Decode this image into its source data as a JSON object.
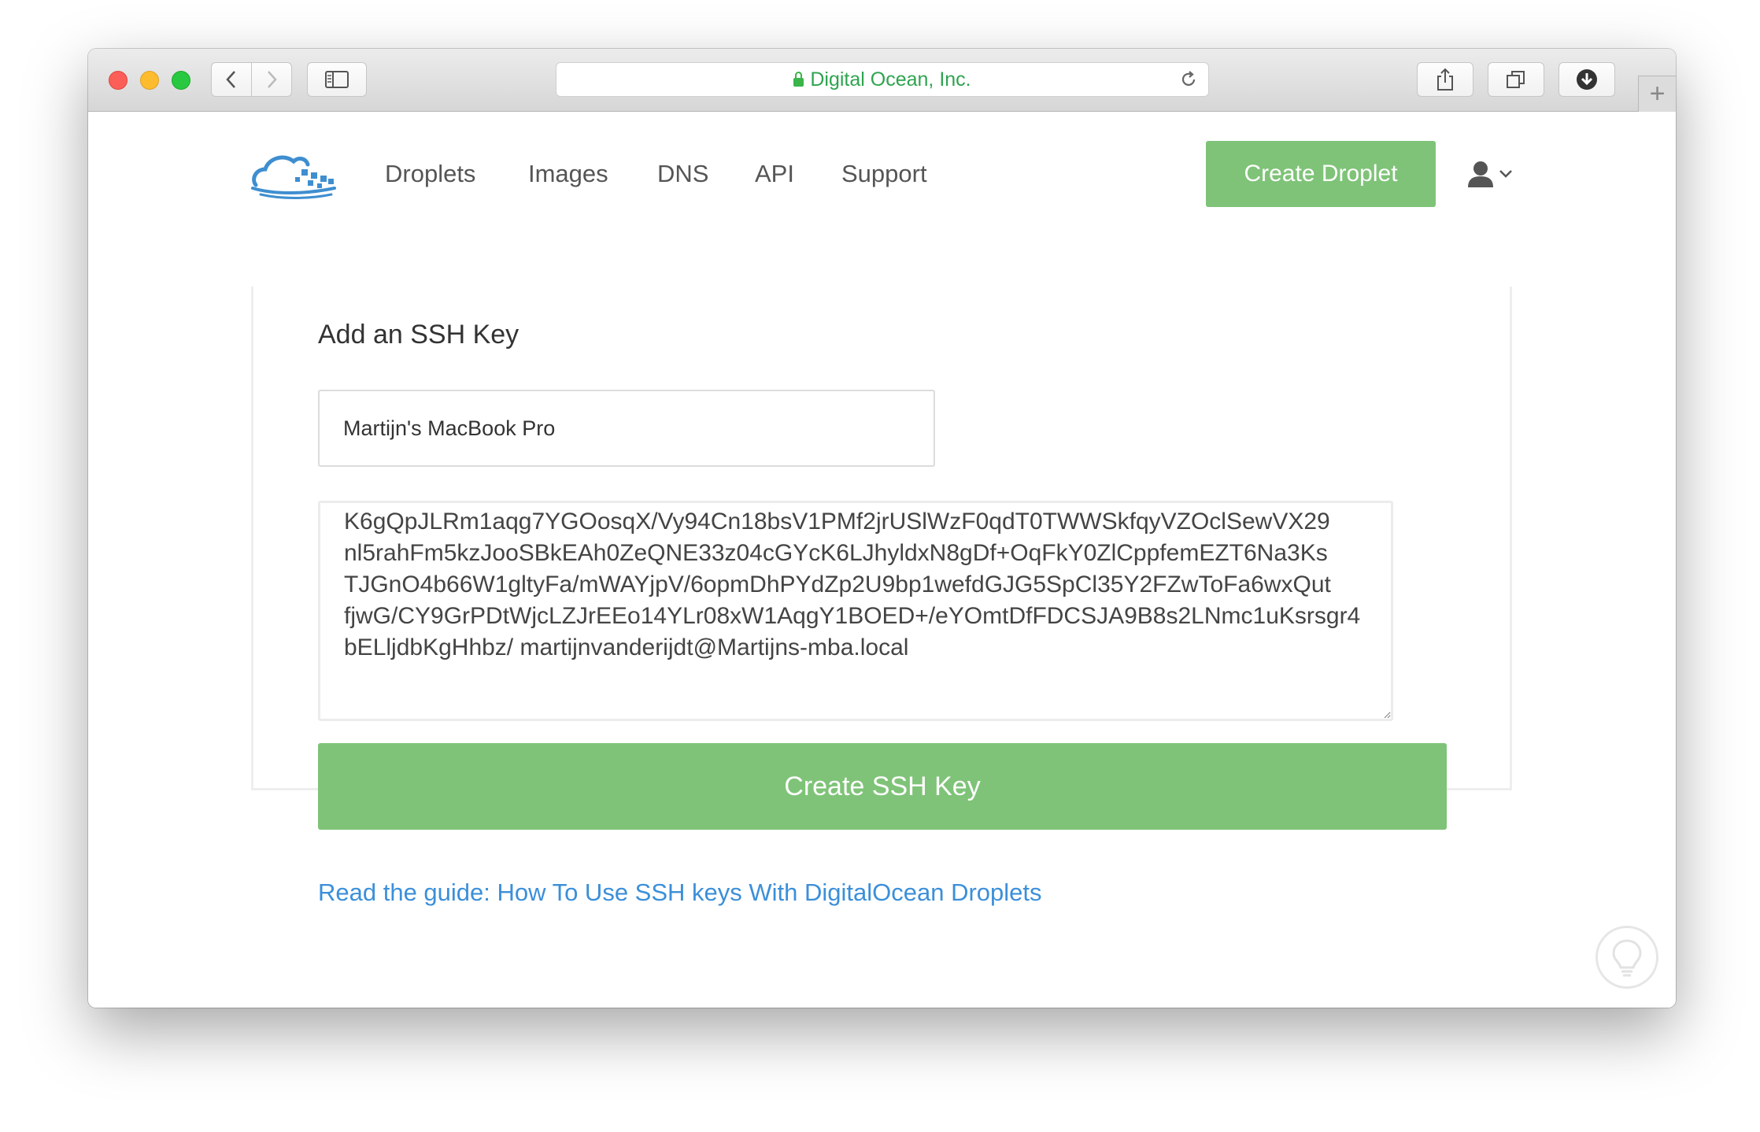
{
  "browser": {
    "address_site": "Digital Ocean, Inc.",
    "new_tab_label": "+"
  },
  "nav": {
    "items": [
      {
        "label": "Droplets"
      },
      {
        "label": "Images"
      },
      {
        "label": "DNS"
      },
      {
        "label": "API"
      },
      {
        "label": "Support"
      }
    ],
    "create_droplet_label": "Create Droplet"
  },
  "form": {
    "title": "Add an SSH Key",
    "name_value": "Martijn's MacBook Pro",
    "key_value": "K6gQpJLRm1aqg7YGOosqX/Vy94Cn18bsV1PMf2jrUSlWzF0qdT0TWWSkfqyVZOclSewVX29\nnl5rahFm5kzJooSBkEAh0ZeQNE33z04cGYcK6LJhyldxN8gDf+OqFkY0ZlCppfemEZT6Na3Ks\nTJGnO4b66W1gltyFa/mWAYjpV/6opmDhPYdZp2U9bp1wefdGJG5SpCl35Y2FZwToFa6wxQut\nfjwG/CY9GrPDtWjcLZJrEEo14YLr08xW1AqgY1BOED+/eYOmtDfFDCSJA9B8s2LNmc1uKsrsgr4\nbELljdbKgHhbz/ martijnvanderijdt@Martijns-mba.local",
    "submit_label": "Create SSH Key",
    "guide_link": "Read the guide: How To Use SSH keys With DigitalOcean Droplets"
  },
  "icons": {
    "lock": "lock-icon",
    "reload": "reload-icon",
    "share": "share-icon",
    "tabs": "tabs-icon",
    "download": "download-icon",
    "user": "user-icon",
    "help": "lightbulb-icon"
  },
  "colors": {
    "accent_green": "#7fc378",
    "link_blue": "#3b8fd9",
    "secure_green": "#2ea44f"
  }
}
